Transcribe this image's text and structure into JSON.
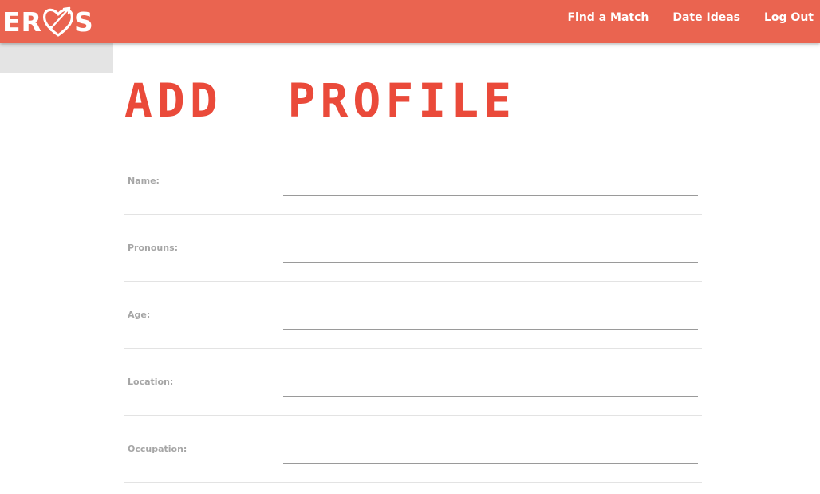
{
  "brand": {
    "logo_left": "ER",
    "logo_right": "S",
    "nav_color": "#ea6450",
    "accent_color": "#ea4a3a"
  },
  "nav": {
    "links": [
      {
        "label": "Find a Match"
      },
      {
        "label": "Date Ideas"
      },
      {
        "label": "Log Out"
      }
    ]
  },
  "page": {
    "title": "ADD  PROFILE"
  },
  "form": {
    "fields": [
      {
        "label": "Name:",
        "value": "",
        "placeholder": ""
      },
      {
        "label": "Pronouns:",
        "value": "",
        "placeholder": ""
      },
      {
        "label": "Age:",
        "value": "",
        "placeholder": ""
      },
      {
        "label": "Location:",
        "value": "",
        "placeholder": ""
      },
      {
        "label": "Occupation:",
        "value": "",
        "placeholder": ""
      }
    ]
  }
}
